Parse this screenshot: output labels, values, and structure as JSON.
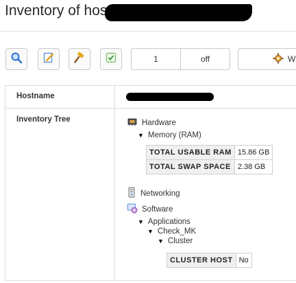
{
  "header": {
    "title": "Inventory of host"
  },
  "toolbar": {
    "buttons": [
      {
        "icon": "search-icon"
      },
      {
        "icon": "edit-icon"
      },
      {
        "icon": "hammer-icon"
      },
      {
        "icon": "checkbox-icon"
      }
    ],
    "num_value": "1",
    "num_state": "off",
    "view_label": "W..."
  },
  "table": {
    "hostname_label": "Hostname",
    "inventory_label": "Inventory Tree"
  },
  "tree": {
    "hardware": "Hardware",
    "memory": "Memory (RAM)",
    "memory_rows": [
      {
        "key": "TOTAL USABLE RAM",
        "value": "15.86 GB"
      },
      {
        "key": "TOTAL SWAP SPACE",
        "value": "2.38 GB"
      }
    ],
    "networking": "Networking",
    "software": "Software",
    "applications": "Applications",
    "check_mk": "Check_MK",
    "cluster": "Cluster",
    "cluster_rows": [
      {
        "key": "CLUSTER HOST",
        "value": "No"
      }
    ]
  },
  "colors": {
    "border": "#c9c9c9",
    "key_bg": "#f0f0f0",
    "search_blue": "#2a6fcf"
  }
}
